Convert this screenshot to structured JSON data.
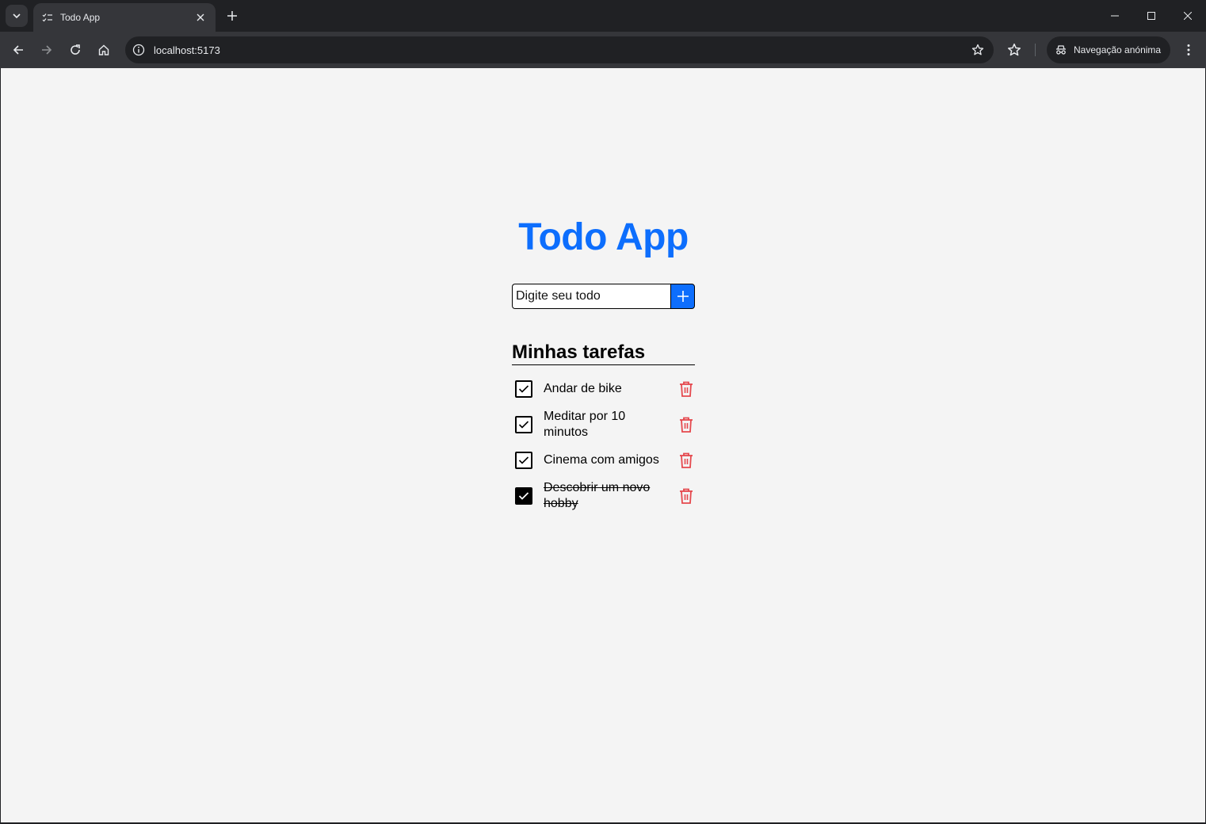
{
  "browser": {
    "tab_title": "Todo App",
    "url": "localhost:5173",
    "incognito_label": "Navegação anónima"
  },
  "app": {
    "title": "Todo App",
    "input_placeholder": "Digite seu todo",
    "list_title": "Minhas tarefas",
    "todos": [
      {
        "text": "Andar de bike",
        "done": false
      },
      {
        "text": "Meditar por 10 minutos",
        "done": false
      },
      {
        "text": "Cinema com amigos",
        "done": false
      },
      {
        "text": "Descobrir um novo hobby",
        "done": true
      }
    ]
  },
  "colors": {
    "accent": "#0d6efd",
    "delete": "#e5484d",
    "page_bg": "#f4f4f4",
    "chrome_dark": "#202124",
    "chrome_toolbar": "#35363a"
  }
}
